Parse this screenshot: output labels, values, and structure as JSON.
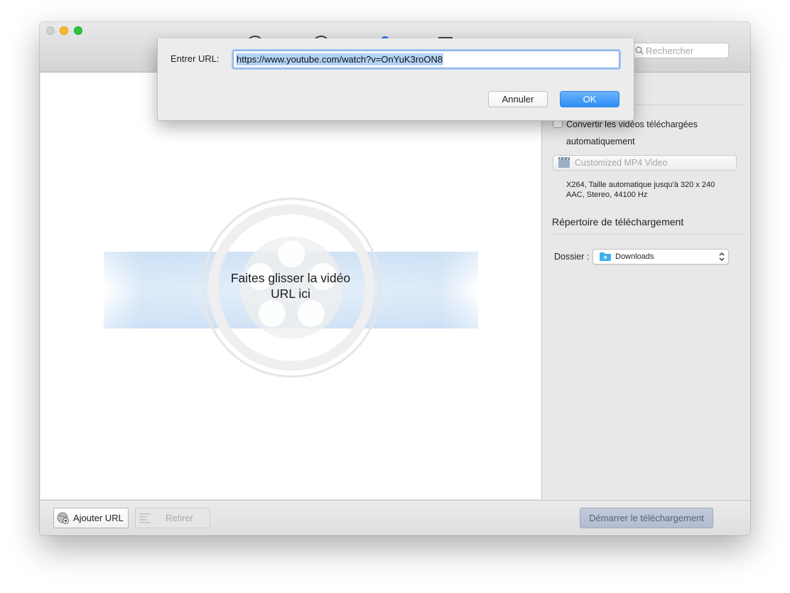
{
  "window": {
    "search": {
      "placeholder": "Rechercher",
      "icon": "search-icon"
    }
  },
  "main": {
    "drop_hint_line1": "Faites glisser la vidéo",
    "drop_hint_line2": "URL ici",
    "logo_icon": "film-reel-icon"
  },
  "sidebar": {
    "convert_checked": false,
    "convert_label": "Convertir les vidéos téléchargées automatiquement",
    "preset_label": "Customized MP4 Video",
    "preset_icon": "clapperboard-icon",
    "preset_desc_line1": "X264, Taille automatique jusqu'à 320 x 240",
    "preset_desc_line2": "AAC, Stereo, 44100 Hz",
    "download_section_title": "Répertoire de téléchargement",
    "folder_label": "Dossier :",
    "folder_value": "Downloads",
    "folder_icon": "folder-icon"
  },
  "bottombar": {
    "add_url_label": "Ajouter URL",
    "remove_label": "Retirer",
    "start_label": "Démarrer le téléchargement"
  },
  "dialog": {
    "label": "Entrer URL:",
    "url_value": "https://www.youtube.com/watch?v=OnYuK3roON8",
    "cancel_label": "Annuler",
    "ok_label": "OK"
  },
  "colors": {
    "ok_button": "#2e8ef6",
    "traffic_min": "#f5b928",
    "traffic_max": "#30c33f",
    "selection": "#b3d3f7"
  }
}
